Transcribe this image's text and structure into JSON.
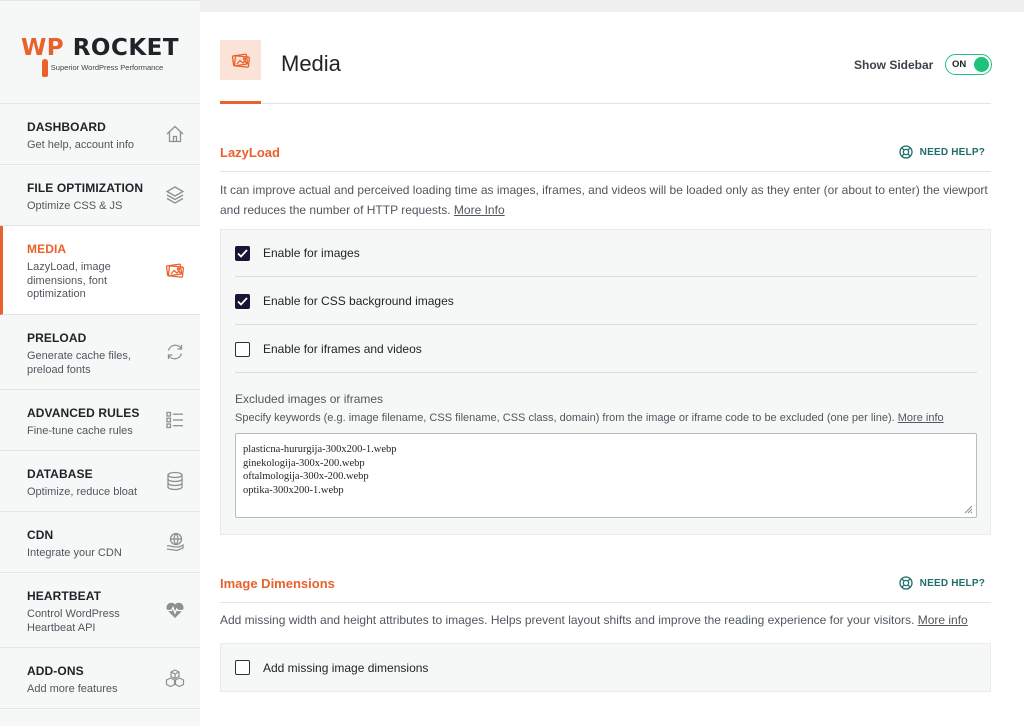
{
  "logo": {
    "wp": "WP",
    "rocket": "ROCKET",
    "tagline": "Superior WordPress Performance"
  },
  "sidebar": {
    "items": [
      {
        "title": "DASHBOARD",
        "desc": "Get help, account info",
        "icon": "home-icon"
      },
      {
        "title": "FILE OPTIMIZATION",
        "desc": "Optimize CSS & JS",
        "icon": "layers-icon"
      },
      {
        "title": "MEDIA",
        "desc": "LazyLoad, image dimensions, font optimization",
        "icon": "media-icon"
      },
      {
        "title": "PRELOAD",
        "desc": "Generate cache files, preload fonts",
        "icon": "refresh-icon"
      },
      {
        "title": "ADVANCED RULES",
        "desc": "Fine-tune cache rules",
        "icon": "list-icon"
      },
      {
        "title": "DATABASE",
        "desc": "Optimize, reduce bloat",
        "icon": "database-icon"
      },
      {
        "title": "CDN",
        "desc": "Integrate your CDN",
        "icon": "globe-hand-icon"
      },
      {
        "title": "HEARTBEAT",
        "desc": "Control WordPress Heartbeat API",
        "icon": "heartbeat-icon"
      },
      {
        "title": "ADD-ONS",
        "desc": "Add more features",
        "icon": "cubes-icon"
      }
    ]
  },
  "header": {
    "title": "Media",
    "show_sidebar_label": "Show Sidebar",
    "toggle_label": "ON"
  },
  "lazyload": {
    "title": "LazyLoad",
    "need_help": "NEED HELP?",
    "desc": "It can improve actual and perceived loading time as images, iframes, and videos will be loaded only as they enter (or about to enter) the viewport and reduces the number of HTTP requests.",
    "more_info": "More Info",
    "options": [
      {
        "label": "Enable for images",
        "checked": true
      },
      {
        "label": "Enable for CSS background images",
        "checked": true
      },
      {
        "label": "Enable for iframes and videos",
        "checked": false
      }
    ],
    "excluded_title": "Excluded images or iframes",
    "excluded_desc": "Specify keywords (e.g. image filename, CSS filename, CSS class, domain) from the image or iframe code to be excluded (one per line).",
    "excluded_more": "More info",
    "excluded_values": [
      "plasticna-hururgija-300x200-1.webp",
      "ginekologija-300x-200.webp",
      "oftalmologija-300x-200.webp",
      "optika-300x200-1.webp"
    ]
  },
  "image_dimensions": {
    "title": "Image Dimensions",
    "need_help": "NEED HELP?",
    "desc": "Add missing width and height attributes to images. Helps prevent layout shifts and improve the reading experience for your visitors.",
    "more_info": "More info",
    "option_label": "Add missing image dimensions",
    "option_checked": false
  },
  "colors": {
    "accent": "#e9612b",
    "toggle_on": "#1ec37a",
    "help_teal": "#1f6e6a",
    "checkbox": "#1b1437"
  }
}
